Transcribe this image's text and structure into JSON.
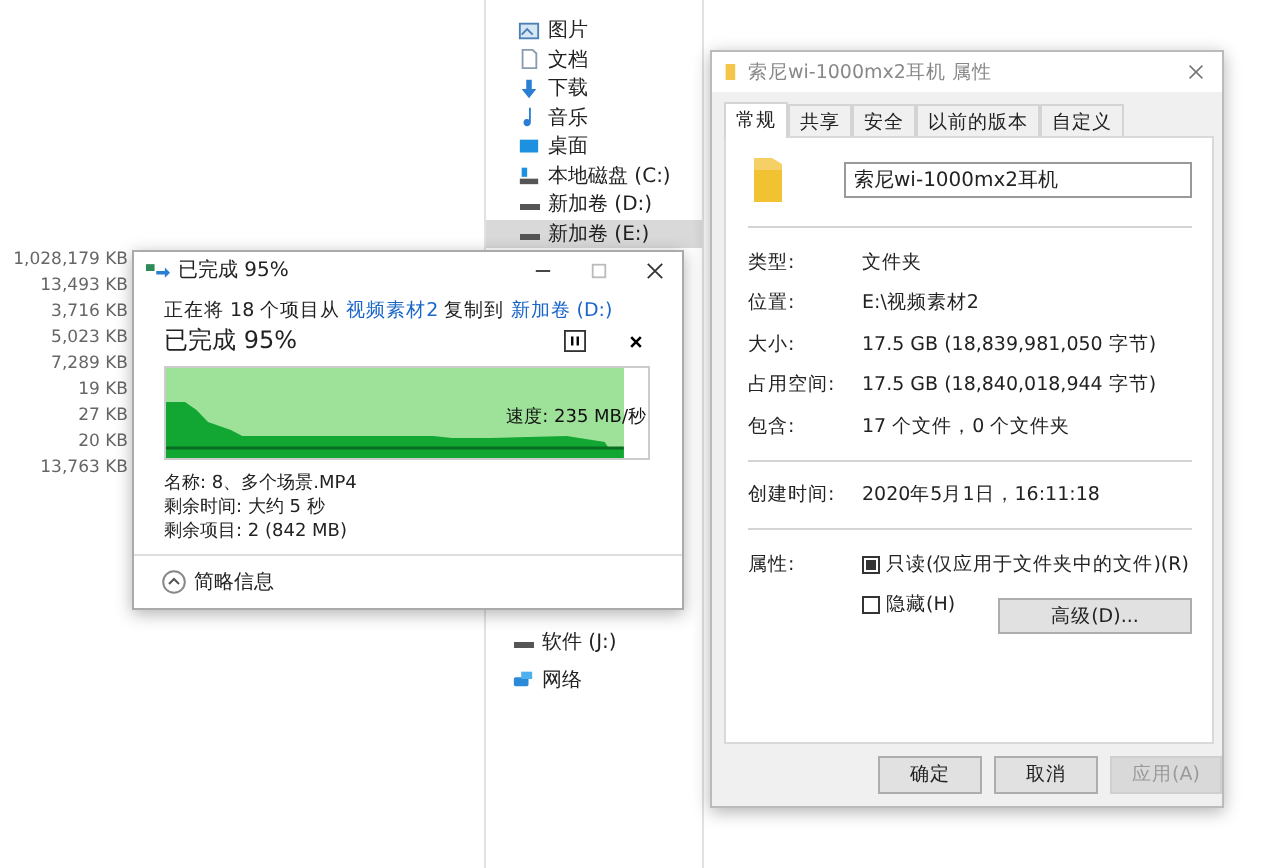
{
  "explorer": {
    "sizes": [
      "1,028,179 KB",
      "13,493 KB",
      "3,716 KB",
      "5,023 KB",
      "7,289 KB",
      "19 KB",
      "27 KB",
      "20 KB",
      "13,763 KB"
    ],
    "nav_top": [
      {
        "label": "图片",
        "kind": "picture",
        "selected": false
      },
      {
        "label": "文档",
        "kind": "document",
        "selected": false
      },
      {
        "label": "下载",
        "kind": "download",
        "selected": false
      },
      {
        "label": "音乐",
        "kind": "music",
        "selected": false
      },
      {
        "label": "桌面",
        "kind": "desktop",
        "selected": false
      },
      {
        "label": "本地磁盘 (C:)",
        "kind": "system-disk",
        "selected": false
      },
      {
        "label": "新加卷 (D:)",
        "kind": "drive",
        "selected": false
      },
      {
        "label": "新加卷 (E:)",
        "kind": "drive",
        "selected": true
      }
    ],
    "nav_bottom": [
      {
        "label": "软件 (J:)",
        "kind": "drive",
        "selected": false
      },
      {
        "label": "网络",
        "kind": "network",
        "selected": false
      }
    ]
  },
  "copy_dialog": {
    "title": "已完成 95%",
    "status": [
      {
        "text": "正在将 18 个项目从 ",
        "kind": "text"
      },
      {
        "text": "视频素材2",
        "kind": "link"
      },
      {
        "text": " 复制到 ",
        "kind": "text"
      },
      {
        "text": "新加卷 (D:)",
        "kind": "link"
      }
    ],
    "heading": "已完成 95%",
    "level": 0.95,
    "speed": "速度: 235 MB/秒",
    "details": [
      "名称: 8、多个场景.MP4",
      "剩余时间: 大约 5 秒",
      "剩余项目: 2 (842 MB)"
    ],
    "toggle": "简略信息"
  },
  "properties": {
    "title": "索尼wi-1000mx2耳机 属性",
    "tabs": [
      {
        "label": "常规",
        "selected": true
      },
      {
        "label": "共享",
        "selected": false
      },
      {
        "label": "安全",
        "selected": false
      },
      {
        "label": "以前的版本",
        "selected": false
      },
      {
        "label": "自定义",
        "selected": false
      }
    ],
    "name": "索尼wi-1000mx2耳机",
    "groups": [
      [
        {
          "label": "类型:",
          "value": "文件夹"
        },
        {
          "label": "位置:",
          "value": "E:\\视频素材2"
        },
        {
          "label": "大小:",
          "value": "17.5 GB (18,839,981,050 字节)"
        },
        {
          "label": "占用空间:",
          "value": "17.5 GB (18,840,018,944 字节)"
        },
        {
          "label": "包含:",
          "value": "17 个文件，0 个文件夹"
        }
      ],
      [
        {
          "label": "创建时间:",
          "value": "2020年5月1日，16:11:18"
        }
      ]
    ],
    "attributes_label": "属性:",
    "checkboxes": [
      {
        "label": "只读(仅应用于文件夹中的文件)(R)",
        "checked": true
      },
      {
        "label": "隐藏(H)",
        "checked": false
      }
    ],
    "advanced_button": "高级(D)...",
    "buttons": [
      {
        "label": "确定",
        "disabled": false
      },
      {
        "label": "取消",
        "disabled": false
      },
      {
        "label": "应用(A)",
        "disabled": true
      }
    ]
  }
}
